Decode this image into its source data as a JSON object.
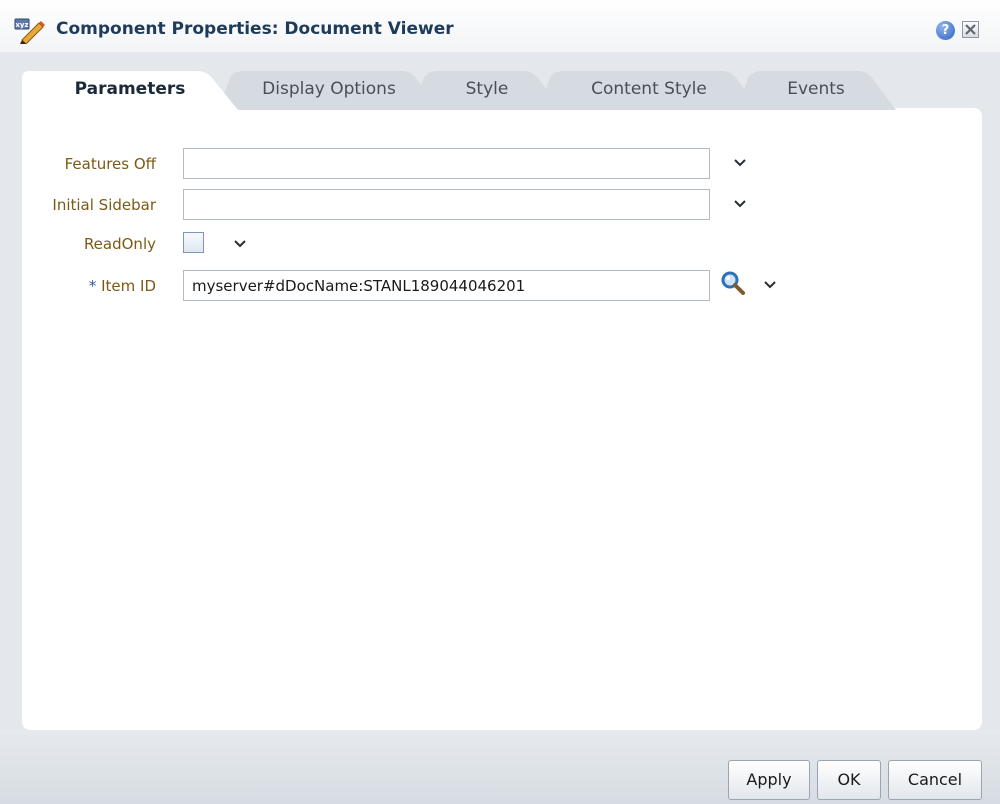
{
  "dialog": {
    "title": "Component Properties: Document Viewer",
    "title_icon": "edit-properties-icon",
    "help_icon_glyph": "?",
    "close_icon": "close-icon"
  },
  "tabs": [
    {
      "label": "Parameters",
      "active": true
    },
    {
      "label": "Display Options",
      "active": false
    },
    {
      "label": "Style",
      "active": false
    },
    {
      "label": "Content Style",
      "active": false
    },
    {
      "label": "Events",
      "active": false
    }
  ],
  "fields": {
    "features_off": {
      "label": "Features Off",
      "value": ""
    },
    "initial_sidebar": {
      "label": "Initial Sidebar",
      "value": ""
    },
    "read_only": {
      "label": "ReadOnly",
      "checked": false
    },
    "item_id": {
      "required_marker": "*",
      "label": "Item ID",
      "value": "myserver#dDocName:STANL189044046201"
    }
  },
  "buttons": {
    "apply": "Apply",
    "ok": "OK",
    "cancel": "Cancel"
  },
  "colors": {
    "label": "#7a5a14",
    "title": "#1f3b5a",
    "required": "#2c5a9c",
    "panel": "#ffffff",
    "chrome": "#e4e8ec"
  }
}
